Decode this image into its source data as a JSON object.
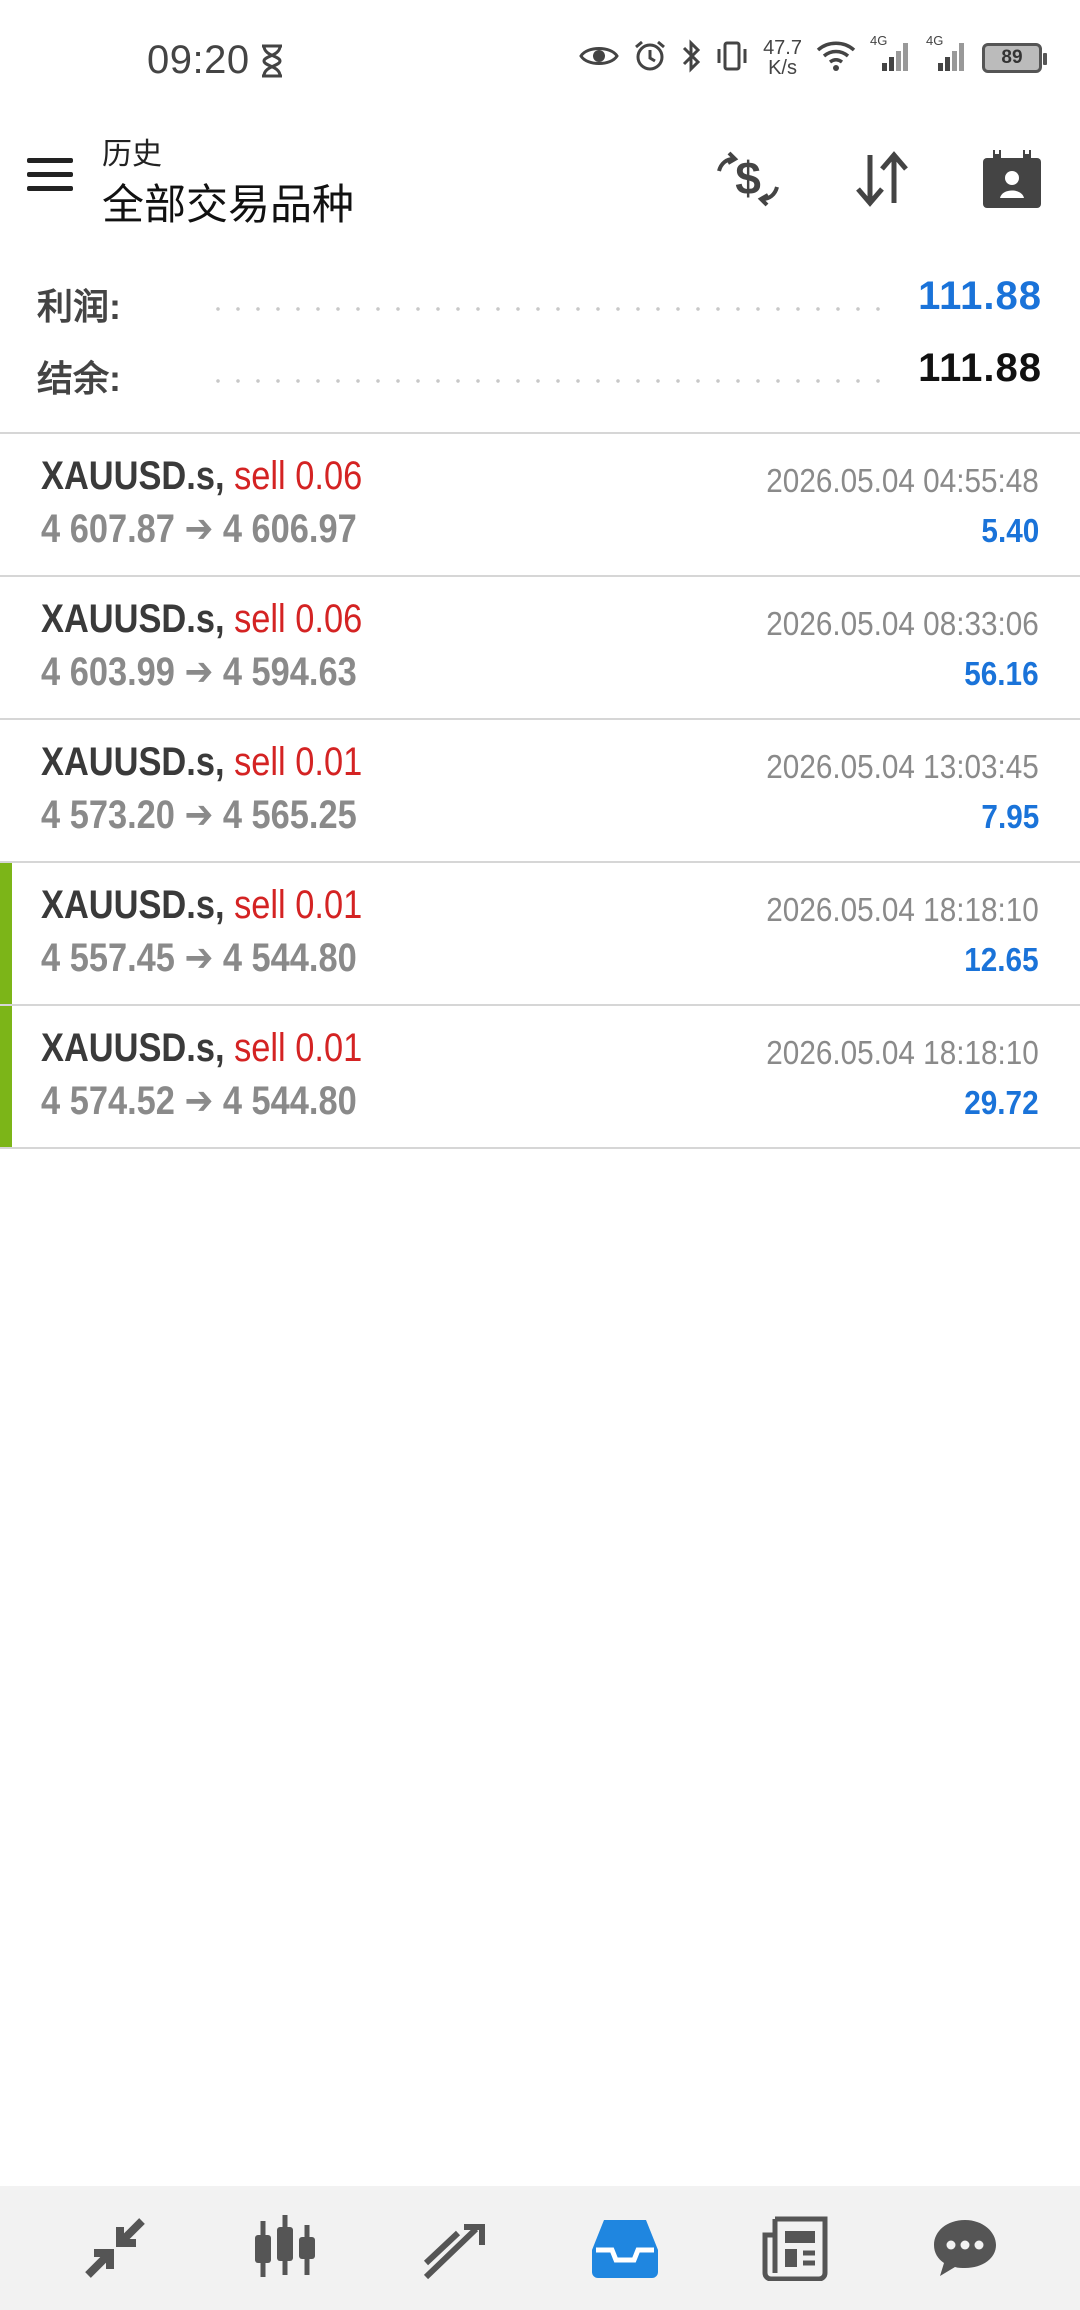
{
  "status_bar": {
    "time": "09:20",
    "net_speed_value": "47.7",
    "net_speed_unit": "K/s",
    "battery": "89",
    "signal_1": "4G",
    "signal_2": "4G"
  },
  "header": {
    "subtitle": "历史",
    "title": "全部交易品种"
  },
  "summary": {
    "profit_label": "利润:",
    "profit_value": "111.88",
    "balance_label": "结余:",
    "balance_value": "111.88"
  },
  "deals": [
    {
      "symbol": "XAUUSD.s,",
      "side": "sell 0.06",
      "prices": "4 607.87 ➔ 4 606.97",
      "time": "2026.05.04 04:55:48",
      "profit": "5.40"
    },
    {
      "symbol": "XAUUSD.s,",
      "side": "sell 0.06",
      "prices": "4 603.99 ➔ 4 594.63",
      "time": "2026.05.04 08:33:06",
      "profit": "56.16"
    },
    {
      "symbol": "XAUUSD.s,",
      "side": "sell 0.01",
      "prices": "4 573.20 ➔ 4 565.25",
      "time": "2026.05.04 13:03:45",
      "profit": "7.95"
    },
    {
      "symbol": "XAUUSD.s,",
      "side": "sell 0.01",
      "prices": "4 557.45 ➔ 4 544.80",
      "time": "2026.05.04 18:18:10",
      "profit": "12.65"
    },
    {
      "symbol": "XAUUSD.s,",
      "side": "sell 0.01",
      "prices": "4 574.52 ➔ 4 544.80",
      "time": "2026.05.04 18:18:10",
      "profit": "29.72"
    }
  ],
  "colors": {
    "accent": "#1a73d9",
    "sell": "#d42323",
    "marker": "#7cb518"
  },
  "bottom_nav": [
    "quotes-icon",
    "chart-candles-icon",
    "trade-icon",
    "history-inbox-icon",
    "news-icon",
    "chat-icon"
  ]
}
